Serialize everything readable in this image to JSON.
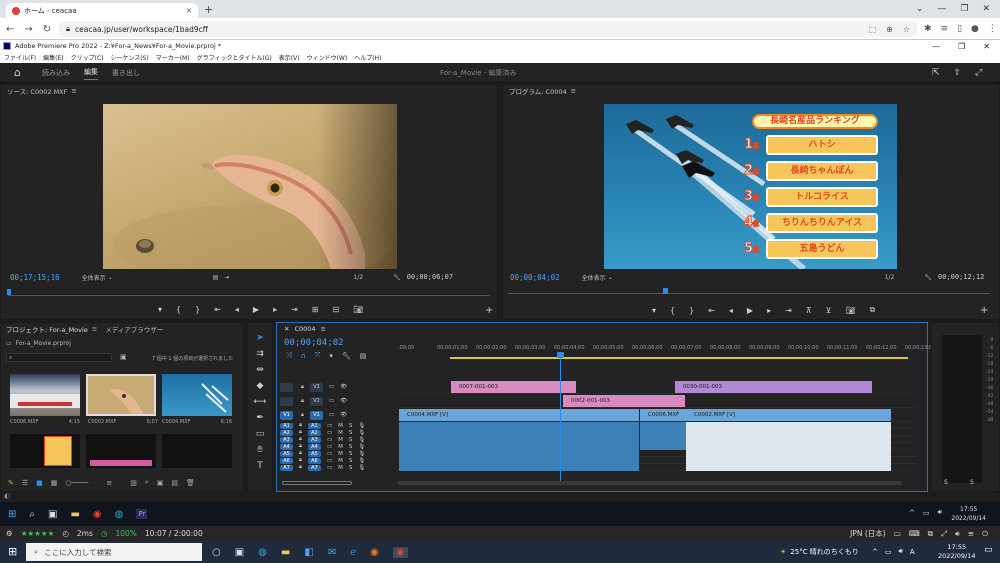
{
  "browser": {
    "tab_title": "ホーム - ceacaa",
    "url": "ceacaa.jp/user/workspace/1bad9cff"
  },
  "premiere": {
    "title": "Adobe Premiere Pro 2022 - Z:¥For-a_News¥For-a_Movie.prproj *",
    "menus": [
      "ファイル(F)",
      "編集(E)",
      "クリップ(C)",
      "シーケンス(S)",
      "マーカー(M)",
      "グラフィックとタイトル(G)",
      "表示(V)",
      "ウィンドウ(W)",
      "ヘルプ(H)"
    ],
    "workspace_tabs": [
      "読み込み",
      "編集",
      "書き出し"
    ],
    "workspace_title": "For-a_Movie - 編集済み",
    "source": {
      "label": "ソース: C0002.MXF",
      "timecode_in": "00;17;15;16",
      "fit": "全体表示",
      "ratio": "1/2",
      "timecode_out": "00;00;06;07"
    },
    "program": {
      "label": "プログラム: C0004",
      "timecode_in": "00;00;04;02",
      "fit": "全体表示",
      "ratio": "1/2",
      "timecode_out": "00;00;12;12"
    },
    "ranking": {
      "title": "長崎名産品ランキング",
      "items": [
        {
          "rank": "1",
          "suffix": "位",
          "name": "ハトシ"
        },
        {
          "rank": "2",
          "suffix": "位",
          "name": "長崎ちゃんぽん"
        },
        {
          "rank": "3",
          "suffix": "位",
          "name": "トルコライス"
        },
        {
          "rank": "4",
          "suffix": "位",
          "name": "ちりんちりんアイス"
        },
        {
          "rank": "5",
          "suffix": "位",
          "name": "五島うどん"
        }
      ]
    },
    "project": {
      "tab_project": "プロジェクト: For-a_Movie",
      "tab_media": "メディアブラウザー",
      "path": "For-a_Movie.prproj",
      "status": "7 個中 1 個の項目が選択されました",
      "items": [
        {
          "name": "C0006.MXF",
          "duration": "4;15"
        },
        {
          "name": "C0002.MXF",
          "duration": "6;07"
        },
        {
          "name": "C0004.MXF",
          "duration": "6;16"
        }
      ]
    },
    "timeline": {
      "tab": "C0004",
      "timecode": "00;00;04;02",
      "ruler": [
        ":00;00",
        "00;00;01;00",
        "00;00;02;00",
        "00;00;03;00",
        "00;00;04;00",
        "00;00;05;00",
        "00;00;06;00",
        "00;00;07;00",
        "00;00;08;00",
        "00;00;09;00",
        "00;00;10;00",
        "00;00;11;00",
        "00;00;12;00",
        "00;00;13;00"
      ],
      "video_tracks": [
        "V3",
        "V2",
        "V1"
      ],
      "audio_tracks": [
        "A1",
        "A2",
        "A3",
        "A4",
        "A5",
        "A6",
        "A7"
      ],
      "clips": {
        "v3a": "0007-001-003",
        "v3b": "0030-001-003",
        "v2": "0002-001-003",
        "v1a": "C0004.MXF [V]",
        "v1b": "C0006.MXF",
        "v1c": "C0002.MXF [V]"
      }
    },
    "meter": {
      "left": "S",
      "right": "S"
    }
  },
  "remote_taskbar": {
    "time": "17:55",
    "date": "2022/09/14"
  },
  "session": {
    "stars": "★★★★★",
    "latency": "2ms",
    "quality": "100%",
    "elapsed": "10:07 / 2:00:00",
    "ime": "JPN (日本)"
  },
  "taskbar": {
    "search_placeholder": "ここに入力して検索",
    "weather": "25°C 晴れのちくもり",
    "time": "17:55",
    "date": "2022/09/14"
  }
}
